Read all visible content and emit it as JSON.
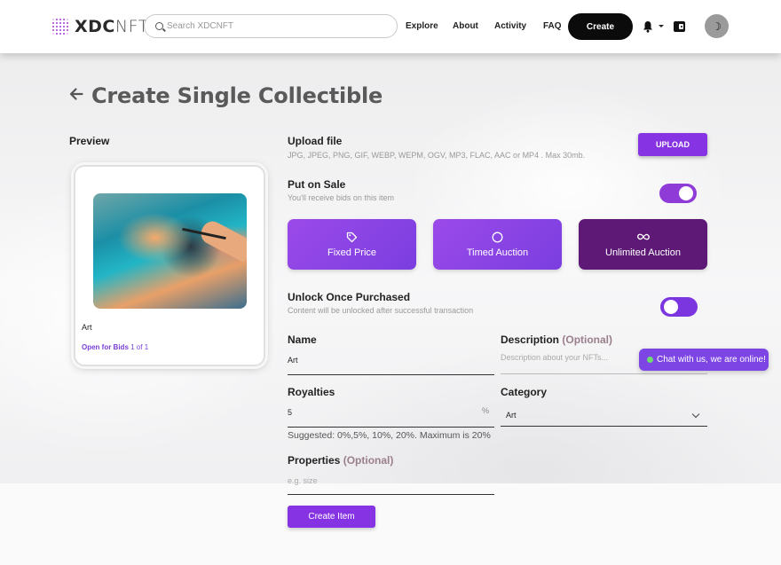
{
  "header": {
    "logo_bold": "XDC",
    "logo_light": "NFT",
    "search_placeholder": "Search XDCNFT",
    "nav": [
      "Explore",
      "About",
      "Activity",
      "FAQ"
    ],
    "create_label": "Create",
    "theme_icon": "☽"
  },
  "page": {
    "title": "Create Single Collectible"
  },
  "preview": {
    "heading": "Preview",
    "item_name": "Art",
    "status_label": "Open for Bids",
    "edition": "1 of 1"
  },
  "form": {
    "upload": {
      "label": "Upload file",
      "hint": "JPG, JPEG, PNG, GIF, WEBP, WEPM, OGV, MP3, FLAC, AAC or MP4 . Max 30mb.",
      "button": "UPLOAD"
    },
    "sale": {
      "label": "Put on Sale",
      "hint": "You'll receive bids on this item",
      "enabled": true,
      "options": [
        {
          "label": "Fixed Price",
          "icon": "tag-icon"
        },
        {
          "label": "Timed Auction",
          "icon": "clock-icon"
        },
        {
          "label": "Unlimited Auction",
          "icon": "infinity-icon"
        }
      ],
      "selected": "Unlimited Auction"
    },
    "unlock": {
      "label": "Unlock Once Purchased",
      "hint": "Content will be unlocked after successful transaction",
      "enabled": false
    },
    "name": {
      "label": "Name",
      "value": "Art"
    },
    "description": {
      "label": "Description",
      "optional": "(Optional)",
      "placeholder": "Description about your NFTs..."
    },
    "royalties": {
      "label": "Royalties",
      "value": "5",
      "unit": "%",
      "suggestion": "Suggested: 0%,5%, 10%, 20%. Maximum is 20%"
    },
    "category": {
      "label": "Category",
      "value": "Art"
    },
    "properties": {
      "label": "Properties",
      "optional": "(Optional)",
      "placeholder": "e.g. size"
    },
    "submit": "Create Item"
  },
  "chat": {
    "text": "Chat with us, we are online!"
  },
  "colors": {
    "accent": "#8634e3",
    "selected_option": "#5d1975",
    "online_dot": "#6edc6e"
  }
}
